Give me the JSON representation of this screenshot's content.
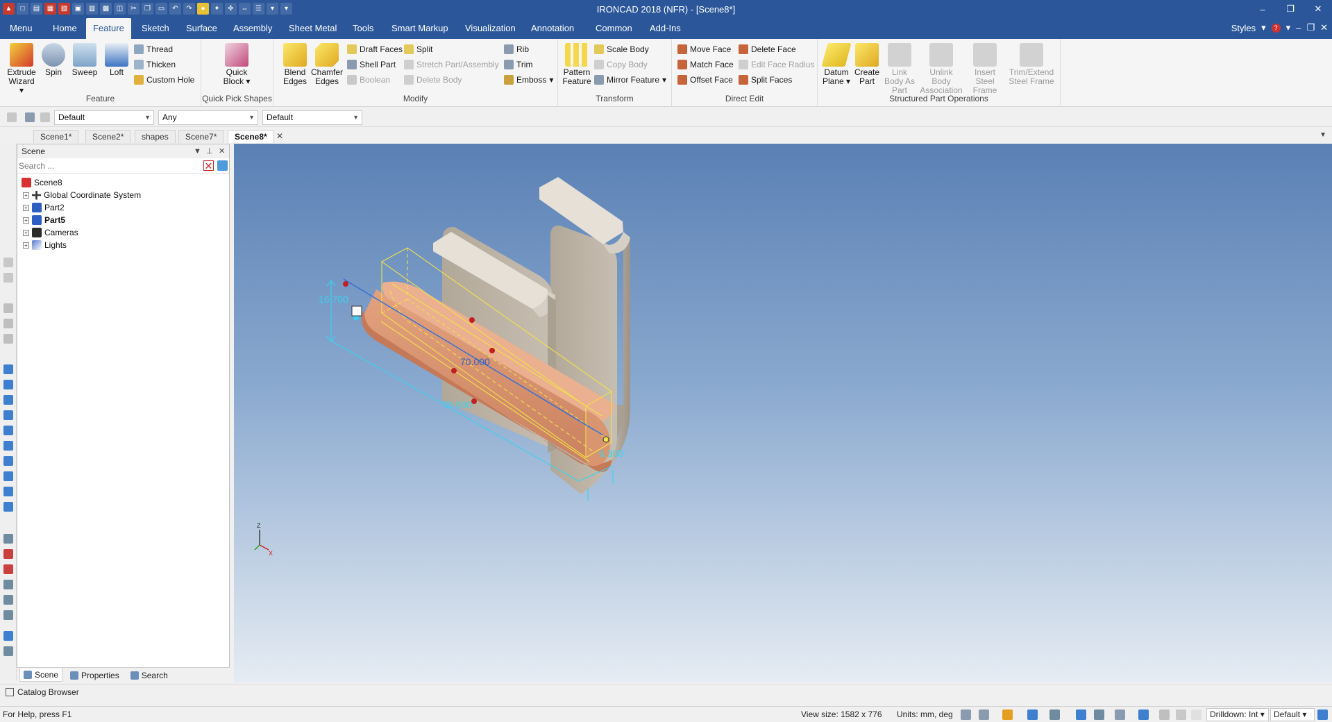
{
  "window": {
    "title": "IRONCAD 2018 (NFR) - [Scene8*]",
    "controls": [
      "–",
      "❐",
      "✕"
    ]
  },
  "menu_tabs": [
    {
      "label": "Menu"
    },
    {
      "label": "Home"
    },
    {
      "label": "Feature",
      "active": true
    },
    {
      "label": "Sketch"
    },
    {
      "label": "Surface"
    },
    {
      "label": "Assembly"
    },
    {
      "label": "Sheet Metal"
    },
    {
      "label": "Tools"
    },
    {
      "label": "Smart Markup"
    },
    {
      "label": "Visualization"
    },
    {
      "label": "Annotation"
    },
    {
      "label": "Common"
    },
    {
      "label": "Add-Ins"
    }
  ],
  "styles_label": "Styles",
  "ribbon": {
    "feature": {
      "label": "Feature",
      "extrude": "Extrude Wizard",
      "spin": "Spin",
      "sweep": "Sweep",
      "loft": "Loft",
      "thread": "Thread",
      "thicken": "Thicken",
      "custom_hole": "Custom Hole"
    },
    "quick_pick": {
      "label": "Quick Pick Shapes",
      "quick_block": "Quick Block"
    },
    "modify": {
      "label": "Modify",
      "blend_edges": "Blend Edges",
      "chamfer_edges": "Chamfer Edges",
      "draft_faces": "Draft Faces",
      "shell_part": "Shell Part",
      "boolean": "Boolean",
      "split": "Split",
      "stretch_part": "Stretch Part/Assembly",
      "delete_body": "Delete Body",
      "rib": "Rib",
      "trim": "Trim",
      "emboss": "Emboss"
    },
    "transform": {
      "label": "Transform",
      "pattern_feature": "Pattern Feature",
      "scale_body": "Scale Body",
      "copy_body": "Copy Body",
      "mirror_feature": "Mirror Feature"
    },
    "direct_edit": {
      "label": "Direct Edit",
      "move_face": "Move Face",
      "match_face": "Match Face",
      "offset_face": "Offset Face",
      "delete_face": "Delete Face",
      "edit_face_radius": "Edit Face Radius",
      "split_faces": "Split Faces"
    },
    "structured": {
      "label": "Structured Part Operations",
      "datum_plane": "Datum Plane",
      "create_part": "Create Part",
      "link_body": "Link Body As Part",
      "unlink_body": "Unlink Body Association",
      "insert_steel": "Insert Steel Frame",
      "trim_extend": "Trim/Extend Steel Frame"
    }
  },
  "toolbar": {
    "combo1": "Default",
    "combo2": "Any",
    "combo3": "Default"
  },
  "doc_tabs": [
    {
      "label": "Scene1*"
    },
    {
      "label": "Scene2*"
    },
    {
      "label": "shapes"
    },
    {
      "label": "Scene7*"
    },
    {
      "label": "Scene8*",
      "active": true
    }
  ],
  "scene_panel": {
    "title": "Scene",
    "search_placeholder": "Search ...",
    "tree": [
      {
        "label": "Scene8",
        "root": true
      },
      {
        "label": "Global Coordinate System"
      },
      {
        "label": "Part2"
      },
      {
        "label": "Part5",
        "bold": true
      },
      {
        "label": "Cameras"
      },
      {
        "label": "Lights"
      }
    ],
    "tabs": [
      {
        "label": "Scene",
        "active": true
      },
      {
        "label": "Properties"
      },
      {
        "label": "Search"
      }
    ]
  },
  "catalog_browser": "Catalog Browser",
  "viewport": {
    "dimensions": {
      "length_top": "70.000",
      "length_bottom": "70.000",
      "height": "16.700",
      "thickness": "6.300"
    },
    "axis_z": "Z",
    "axis_x": "X",
    "colors": {
      "selected_part": "#d99470",
      "highlight": "#f2e24a",
      "dimension": "#38d4f0",
      "bracket": "#c9bfb2"
    }
  },
  "status": {
    "help": "For Help, press F1",
    "view_size": "View size: 1582 x  776",
    "units": "Units: mm, deg",
    "drilldown": "Drilldown: Int",
    "style": "Default"
  }
}
